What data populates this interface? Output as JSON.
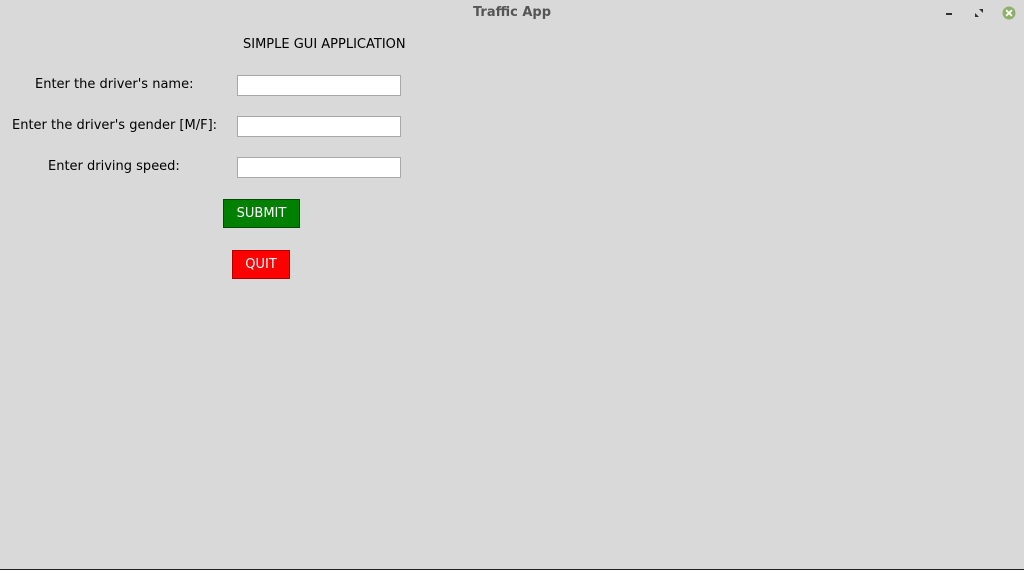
{
  "window": {
    "title": "Traffic App"
  },
  "heading": "SIMPLE GUI APPLICATION",
  "form": {
    "fields": [
      {
        "label": "Enter the driver's name:",
        "value": ""
      },
      {
        "label": "Enter the driver's gender [M/F]:",
        "value": ""
      },
      {
        "label": "Enter driving speed:",
        "value": ""
      }
    ]
  },
  "buttons": {
    "submit_label": "SUBMIT",
    "quit_label": "QUIT"
  },
  "colors": {
    "background": "#d9d9d9",
    "submit": "#008000",
    "quit": "#ff0000",
    "close_icon": "#8fb06a"
  },
  "icons": {
    "minimize": "minimize-icon",
    "maximize": "maximize-icon",
    "close": "close-icon"
  }
}
